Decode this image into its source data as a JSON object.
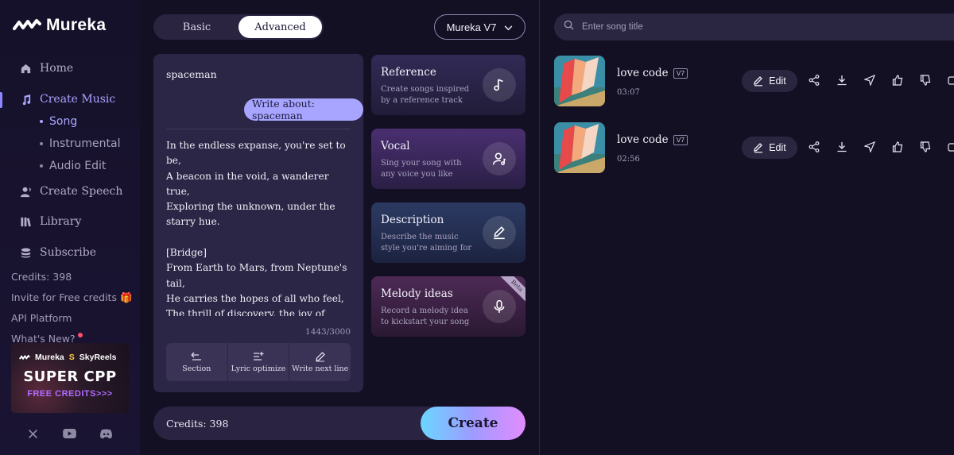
{
  "brand": {
    "name": "Mureka"
  },
  "nav": {
    "home": "Home",
    "create_music": "Create Music",
    "sub": {
      "song": "Song",
      "instrumental": "Instrumental",
      "audio_edit": "Audio Edit"
    },
    "create_speech": "Create Speech",
    "library": "Library",
    "subscribe": "Subscribe"
  },
  "sidebar_info": {
    "credits": "Credits: 398",
    "invite": "Invite for Free credits",
    "api": "API Platform",
    "whats_new": "What's New?"
  },
  "promo": {
    "brand1": "Mureka",
    "brand2": "SkyReels",
    "headline": "SUPER CPP",
    "sub": "FREE CREDITS>>>"
  },
  "mode": {
    "basic": "Basic",
    "advanced": "Advanced"
  },
  "model": {
    "selected": "Mureka V7"
  },
  "lyrics": {
    "title": "spaceman",
    "write_about": "Write about: spaceman",
    "body": "In the endless expanse, you're set to be,\nA beacon in the void, a wanderer true,\nExploring the unknown, under the starry hue.\n\n[Bridge]\nFrom Earth to Mars, from Neptune's tail,\nHe carries the hopes of all who feel,\nThe thrill of discovery, the joy of flight,\nIn the vastness, he's just beginning the right.\n\n[Chorus]\nOh, Voyager, you float free",
    "counter": "1443/3000",
    "tools": {
      "section": "Section",
      "lyric_optimize": "Lyric optimize",
      "write_next": "Write next line"
    }
  },
  "features": {
    "reference": {
      "title": "Reference",
      "desc": "Create songs inspired by a reference track"
    },
    "vocal": {
      "title": "Vocal",
      "desc": "Sing your song with any voice you like"
    },
    "description": {
      "title": "Description",
      "desc": "Describe the music style you're aiming for"
    },
    "melody": {
      "title": "Melody ideas",
      "desc": "Record a melody idea to kickstart your song",
      "badge": "Beta"
    }
  },
  "bottom": {
    "credits": "Credits: 398",
    "create": "Create"
  },
  "search": {
    "placeholder": "Enter song title"
  },
  "songs": [
    {
      "title": "love code",
      "version": "V7",
      "duration": "03:07",
      "edit": "Edit"
    },
    {
      "title": "love code",
      "version": "V7",
      "duration": "02:56",
      "edit": "Edit"
    }
  ],
  "colors": {
    "accent": "#a7a5ff",
    "background": "#141024",
    "card": "#2b2546"
  }
}
